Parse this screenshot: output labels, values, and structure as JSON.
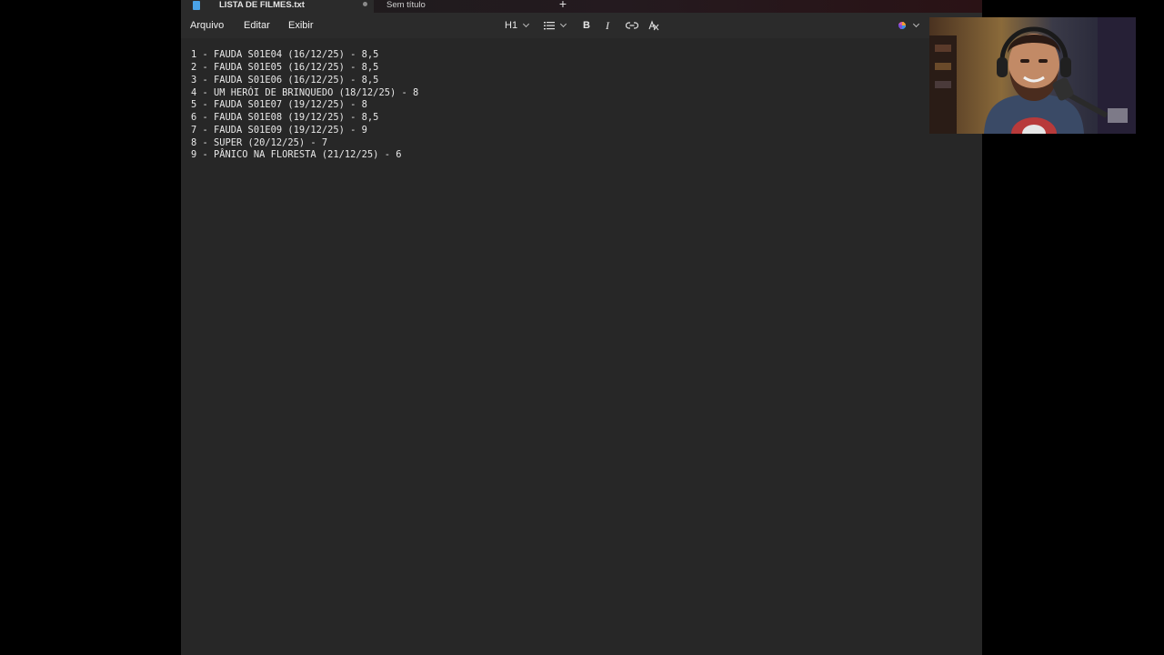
{
  "tabs": [
    {
      "title": "LISTA DE FILMES.txt",
      "active": true,
      "unsaved": true
    },
    {
      "title": "Sem título",
      "active": false
    }
  ],
  "new_tab_symbol": "+",
  "menu": {
    "file": "Arquivo",
    "edit": "Editar",
    "view": "Exibir"
  },
  "format_toolbar": {
    "heading": "H1",
    "list_icon": "bulleted-list-icon",
    "bold": "B",
    "italic": "I",
    "link_icon": "link-icon",
    "clear_format_icon": "clear-formatting-icon",
    "copilot_icon": "copilot-icon"
  },
  "document": {
    "lines": [
      "1 - FAUDA S01E04 (16/12/25) - 8,5",
      "2 - FAUDA S01E05 (16/12/25) - 8,5",
      "3 - FAUDA S01E06 (16/12/25) - 8,5",
      "4 - UM HERÓI DE BRINQUEDO (18/12/25) - 8",
      "5 - FAUDA S01E07 (19/12/25) - 8",
      "6 - FAUDA S01E08 (19/12/25) - 8,5",
      "7 - FAUDA S01E09 (19/12/25) - 9",
      "8 - SUPER (20/12/25) - 7",
      "9 - PÂNICO NA FLORESTA (21/12/25) - 6"
    ]
  },
  "colors": {
    "editor_bg": "#272727",
    "toolbar_bg": "#2b2b2b",
    "outside_bg": "#000000",
    "text": "#e8e8e8",
    "tab_icon": "#4aa3e8"
  }
}
